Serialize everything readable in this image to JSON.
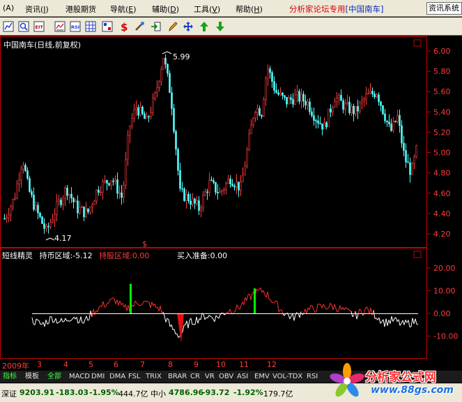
{
  "menu": [
    {
      "label": "(A)"
    },
    {
      "label": "资讯",
      "key": "I"
    },
    {
      "label": "港股期货",
      "key": ""
    },
    {
      "label": "导航",
      "key": "E"
    },
    {
      "label": "辅助",
      "key": "D"
    },
    {
      "label": "工具",
      "key": "V"
    },
    {
      "label": "帮助",
      "key": "H"
    }
  ],
  "forum_label": "分析家论坛专用",
  "forum_bracket": "[中国南车]",
  "sys_button": "资讯系统",
  "toolbar_icons": [
    "curve-icon",
    "zoom-icon",
    "ext-icon",
    "chart-icon",
    "rsi-icon",
    "grid-icon",
    "dollar-icon",
    "wand-icon",
    "export-icon",
    "pencil-icon",
    "move-icon",
    "arrow-up-icon",
    "arrow-down-icon"
  ],
  "chart_title": "中国南车(日线,前复权)",
  "high_label": "5.99",
  "low_label": "4.17",
  "price_axis": [
    "6.00",
    "5.80",
    "5.60",
    "5.40",
    "5.20",
    "5.00",
    "4.80",
    "4.60",
    "4.40",
    "4.20"
  ],
  "indicator": {
    "name": "短线精灵",
    "hold_coin": "持币区域:-5.12",
    "hold_stock": "持股区域:0.00",
    "buy_prep": "买入准备:0.00",
    "axis": [
      "20.00",
      "10.00",
      "0.00",
      "-10.00"
    ]
  },
  "dollar_marker": "$",
  "date_axis": {
    "year": "2009年",
    "months": [
      "3",
      "4",
      "5",
      "6",
      "7",
      "8",
      "9",
      "10",
      "11",
      "12"
    ]
  },
  "tabs": [
    "指标",
    "模板",
    "全部",
    "MACD",
    "DMI",
    "DMA",
    "FSL",
    "TRIX",
    "BRAR",
    "CR",
    "VR",
    "OBV",
    "ASI",
    "EMV",
    "VOL-TDX",
    "RSI"
  ],
  "status": {
    "sh_label": "深证",
    "sh_value": "9203.91",
    "sh_change": "-183.03",
    "sh_pct": "-1.95%",
    "sh_amount": "444.7亿",
    "sm_label": "中小",
    "sm_value": "4786.96",
    "sm_change": "-93.72",
    "sm_pct": "-1.92%",
    "sm_amount": "179.7亿"
  },
  "logo_text": "分析家公式网",
  "logo_url": "www.88gs.com",
  "colors": {
    "up": "#ff3c3c",
    "down": "#54ffff",
    "axis": "#c80000",
    "green": "#00ff00"
  }
}
